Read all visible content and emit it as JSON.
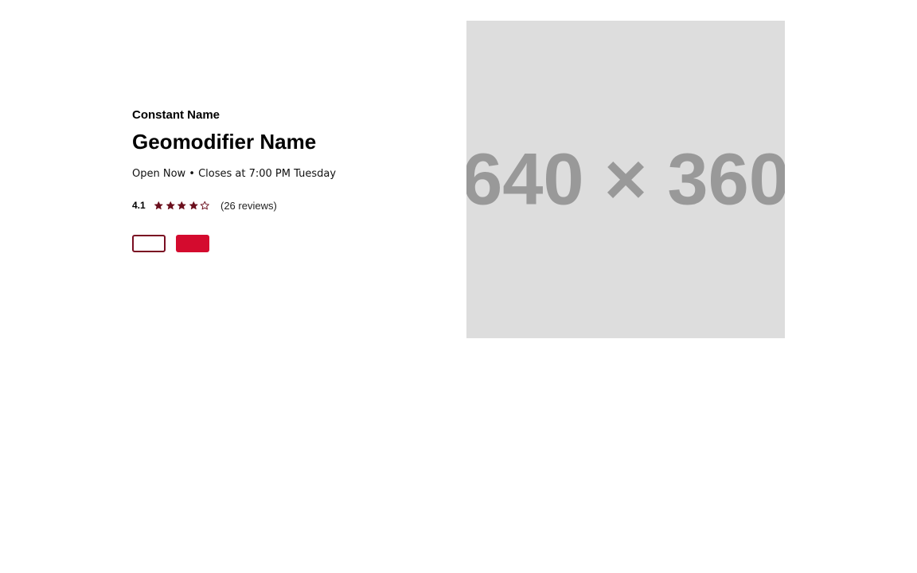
{
  "location": {
    "constant_name": "Constant Name",
    "geomodifier_name": "Geomodifier Name",
    "hours_status": "Open Now • Closes at 7:00 PM Tuesday",
    "rating": "4.1",
    "rating_value": 4.1,
    "rating_max": 5,
    "reviews_text": "(26 reviews)"
  },
  "stars": [
    "star-filled",
    "star-filled",
    "star-filled",
    "star-filled",
    "star-empty"
  ],
  "buttons": {
    "primary_label": "",
    "secondary_label": ""
  },
  "image": {
    "placeholder_text": "640 × 360"
  },
  "colors": {
    "star": "#6b0f1d",
    "button_outline": "#7a0e22",
    "button_fill": "#d40b2e",
    "placeholder_bg": "#dddddd",
    "placeholder_text": "#999999"
  }
}
